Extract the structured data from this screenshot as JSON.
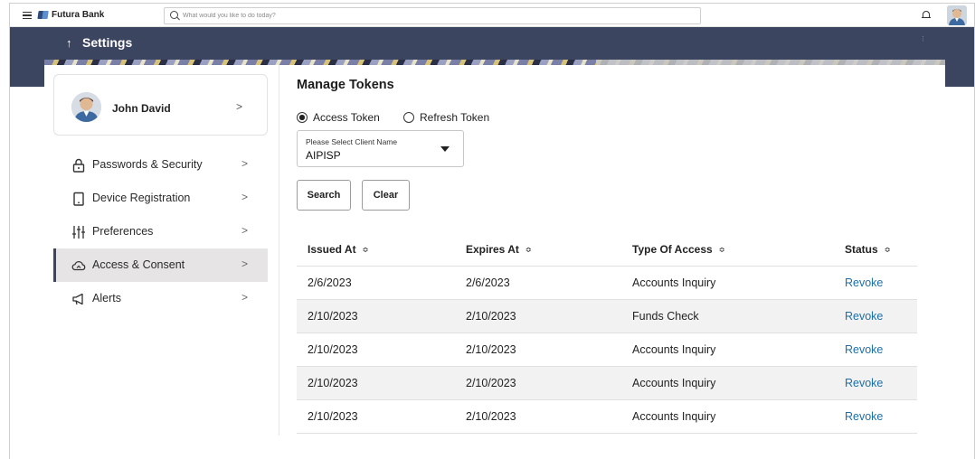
{
  "app": {
    "brand": "Futura Bank"
  },
  "search": {
    "placeholder": "What would you like to do today?"
  },
  "header": {
    "title": "Settings"
  },
  "profile": {
    "name": "John David"
  },
  "sidebar": {
    "items": [
      {
        "label": "Passwords & Security",
        "icon": "lock-icon"
      },
      {
        "label": "Device Registration",
        "icon": "device-icon"
      },
      {
        "label": "Preferences",
        "icon": "sliders-icon"
      },
      {
        "label": "Access & Consent",
        "icon": "cloud-icon",
        "active": true
      },
      {
        "label": "Alerts",
        "icon": "megaphone-icon"
      }
    ]
  },
  "main": {
    "title": "Manage Tokens",
    "radios": [
      {
        "label": "Access Token",
        "checked": true
      },
      {
        "label": "Refresh Token",
        "checked": false
      }
    ],
    "client_select": {
      "caption": "Please Select Client Name",
      "value": "AIPISP"
    },
    "buttons": {
      "search": "Search",
      "clear": "Clear"
    },
    "table": {
      "headers": [
        "Issued At",
        "Expires At",
        "Type Of Access",
        "Status"
      ],
      "rows": [
        [
          "2/6/2023",
          "2/6/2023",
          "Accounts Inquiry",
          "Revoke"
        ],
        [
          "2/10/2023",
          "2/10/2023",
          "Funds Check",
          "Revoke"
        ],
        [
          "2/10/2023",
          "2/10/2023",
          "Accounts Inquiry",
          "Revoke"
        ],
        [
          "2/10/2023",
          "2/10/2023",
          "Accounts Inquiry",
          "Revoke"
        ],
        [
          "2/10/2023",
          "2/10/2023",
          "Accounts Inquiry",
          "Revoke"
        ]
      ]
    }
  },
  "colors": {
    "header_bg": "#3c4560",
    "link": "#1d6fa5",
    "active_row": "#e6e4e4"
  }
}
